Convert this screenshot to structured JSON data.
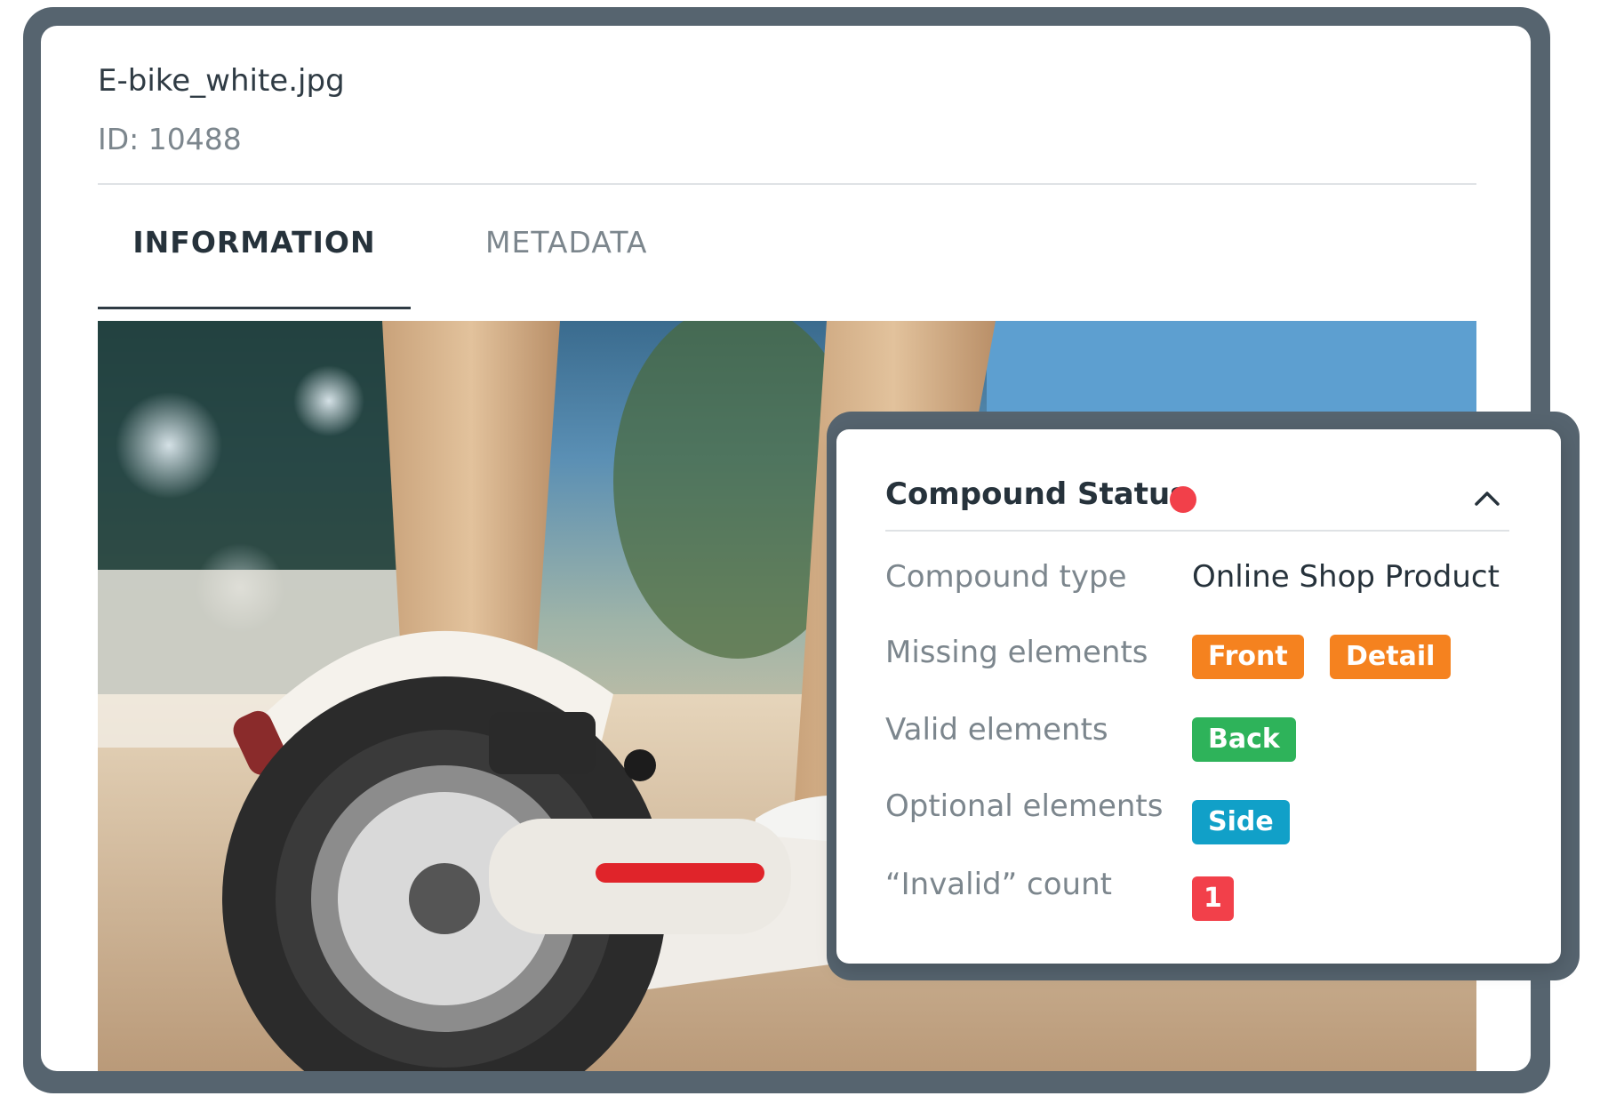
{
  "file": {
    "name": "E-bike_white.jpg",
    "id_text": "ID: 10488"
  },
  "tabs": [
    {
      "label": "INFORMATION",
      "active": true
    },
    {
      "label": "METADATA",
      "active": false
    }
  ],
  "preview": {
    "icon": "photo-preview"
  },
  "panel": {
    "title": "Compound Status",
    "status_color": "#f2404a",
    "collapse_icon": "chevron-up-icon",
    "rows": {
      "compound_type": {
        "label": "Compound type",
        "value": "Online Shop Product"
      },
      "missing": {
        "label": "Missing elements",
        "badges": [
          "Front",
          "Detail"
        ],
        "color": "#f5821f"
      },
      "valid": {
        "label": "Valid elements",
        "badges": [
          "Back"
        ],
        "color": "#2eb35a"
      },
      "optional": {
        "label": "Optional elements",
        "badges": [
          "Side"
        ],
        "color": "#11a0c8"
      },
      "invalid": {
        "label": "“Invalid” count",
        "value": "1",
        "color": "#f2404a"
      }
    }
  }
}
